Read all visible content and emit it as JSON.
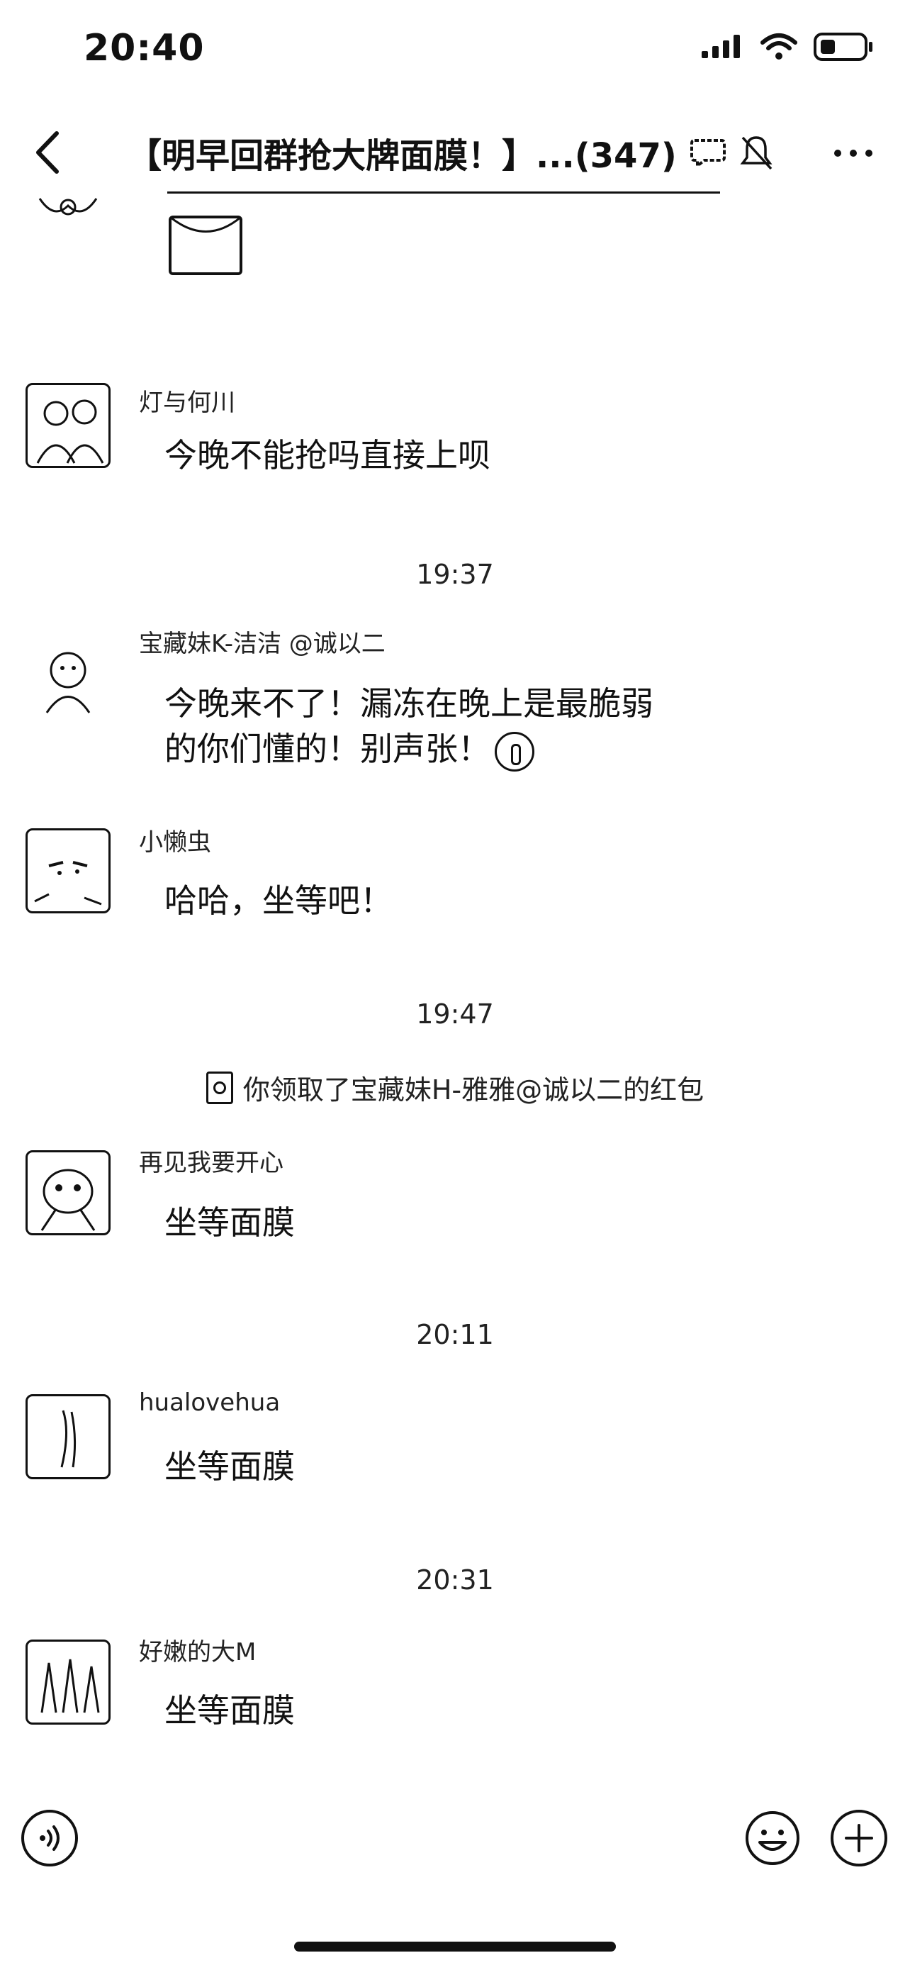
{
  "status_bar": {
    "time": "20:40"
  },
  "nav": {
    "title": "【明早回群抢大牌面膜！】...(347)"
  },
  "messages": [
    {
      "type": "text",
      "sender": "灯与何川",
      "text": "今晚不能抢吗直接上呗"
    },
    {
      "type": "timestamp",
      "text": "19:37"
    },
    {
      "type": "text",
      "sender": "宝藏妹K-洁洁 @诚以二",
      "text_line1": "今晚来不了！漏冻在晚上是最脆弱",
      "text_line2": "的你们懂的！别声张！"
    },
    {
      "type": "text",
      "sender": "小懒虫",
      "text": "哈哈，坐等吧！"
    },
    {
      "type": "timestamp",
      "text": "19:47"
    },
    {
      "type": "system",
      "text": "你领取了宝藏妹H-雅雅@诚以二的红包"
    },
    {
      "type": "text",
      "sender": "再见我要开心",
      "text": "坐等面膜"
    },
    {
      "type": "timestamp",
      "text": "20:11"
    },
    {
      "type": "text",
      "sender": "hualovehua",
      "text": "坐等面膜"
    },
    {
      "type": "timestamp",
      "text": "20:31"
    },
    {
      "type": "text",
      "sender": "好嫩的大M",
      "text": "坐等面膜"
    }
  ],
  "icons": {
    "back": "chevron-left-icon",
    "chat": "chat-bubble-icon",
    "mute": "bell-muted-icon",
    "more": "more-dots-icon",
    "voice": "voice-icon",
    "emoji": "emoji-icon",
    "plus": "plus-icon"
  }
}
